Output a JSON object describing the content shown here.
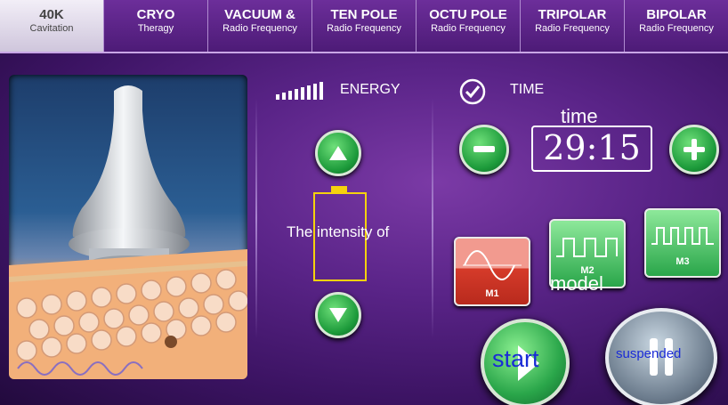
{
  "tabs": [
    {
      "title": "40K",
      "subtitle": "Cavitation"
    },
    {
      "title": "CRYO",
      "subtitle": "Theragy"
    },
    {
      "title": "VACUUM &",
      "subtitle": "Radio Frequency"
    },
    {
      "title": "TEN POLE",
      "subtitle": "Radio Frequency"
    },
    {
      "title": "OCTU POLE",
      "subtitle": "Radio Frequency"
    },
    {
      "title": "TRIPOLAR",
      "subtitle": "Radio Frequency"
    },
    {
      "title": "BIPOLAR",
      "subtitle": "Radio Frequency"
    }
  ],
  "energy": {
    "label": "ENERGY",
    "annotation": "The intensity of"
  },
  "time": {
    "label": "TIME",
    "value": "29:15",
    "annotation": "time"
  },
  "modes": {
    "m1": "M1",
    "m2": "M2",
    "m3": "M3",
    "annotation": "model"
  },
  "controls": {
    "start_annotation": "start",
    "suspend_annotation": "suspended"
  },
  "icons": {
    "minus": "minus-icon",
    "plus": "plus-icon",
    "up": "up-arrow-icon",
    "down": "down-arrow-icon",
    "play": "play-icon",
    "pause": "pause-icon"
  },
  "colors": {
    "m1": "#d63b2a",
    "m2": "#2aa64a",
    "m3": "#2aa64a",
    "start_text": "#1a2bd6",
    "suspend_text": "#1a2bd6"
  }
}
